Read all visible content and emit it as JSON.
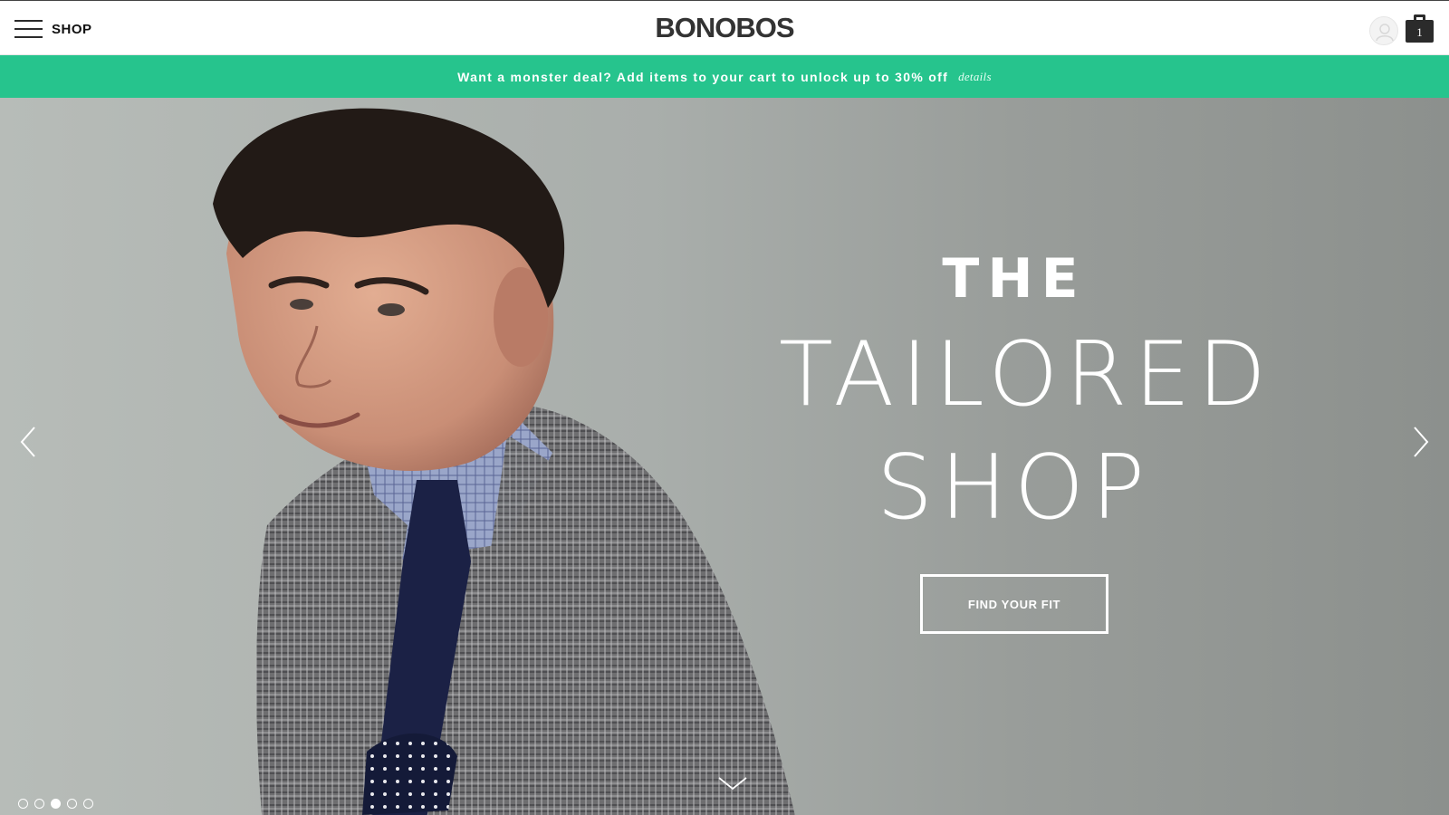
{
  "header": {
    "shop_label": "SHOP",
    "logo": "BONOBOS",
    "cart_count": "1",
    "icons": [
      "hamburger-menu-icon",
      "account-icon",
      "shopping-bag-icon"
    ]
  },
  "promo": {
    "text": "Want a monster deal? Add items to your cart to unlock up to 30% off",
    "details": "details",
    "color": "#26c48d"
  },
  "hero": {
    "title_small": "THE",
    "title_line1": "TAILORED",
    "title_line2": "SHOP",
    "cta": "FIND YOUR FIT",
    "slides_total": 5,
    "active_slide": 3,
    "icons": [
      "chevron-left-icon",
      "chevron-right-icon",
      "chevron-down-icon"
    ]
  }
}
